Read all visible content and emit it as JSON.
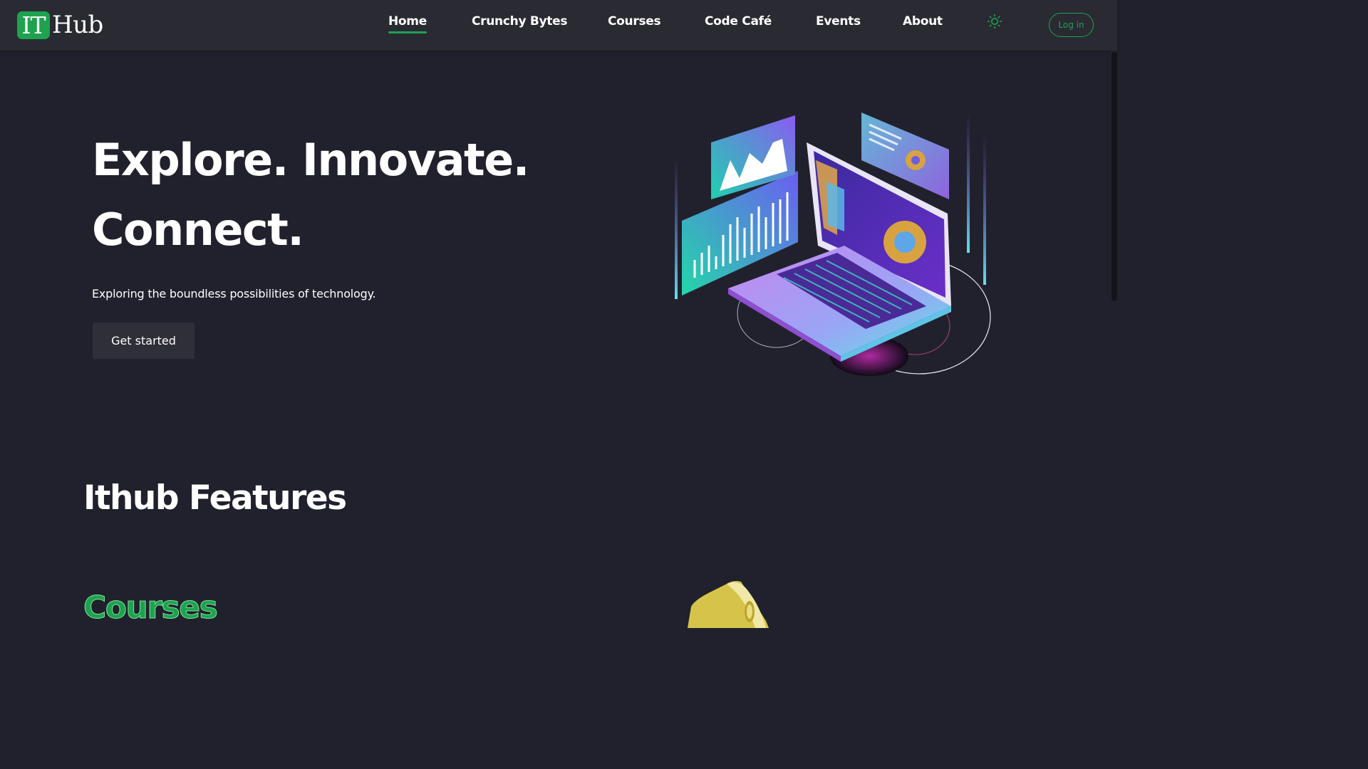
{
  "brand": {
    "logo_left": "IT",
    "logo_right": "Hub"
  },
  "nav": {
    "items": [
      {
        "label": "Home",
        "active": true
      },
      {
        "label": "Crunchy Bytes",
        "active": false
      },
      {
        "label": "Courses",
        "active": false
      },
      {
        "label": "Code Café",
        "active": false
      },
      {
        "label": "Events",
        "active": false
      },
      {
        "label": "About",
        "active": false
      }
    ],
    "theme_toggle_icon": "sun-icon",
    "login_label": "Log in"
  },
  "hero": {
    "title_line1": "Explore. Innovate.",
    "title_line2": "Connect.",
    "subtitle": "Exploring the boundless possibilities of technology.",
    "cta_label": "Get started",
    "illustration_icon": "laptop-analytics-illustration"
  },
  "features": {
    "title": "Ithub Features",
    "first_feature_title": "Courses",
    "first_feature_icon": "megaphone-illustration"
  },
  "colors": {
    "background": "#21212d",
    "navbar": "#2a2a33",
    "accent": "#1ea24f",
    "text": "#ffffff",
    "button": "#2f2f39"
  }
}
